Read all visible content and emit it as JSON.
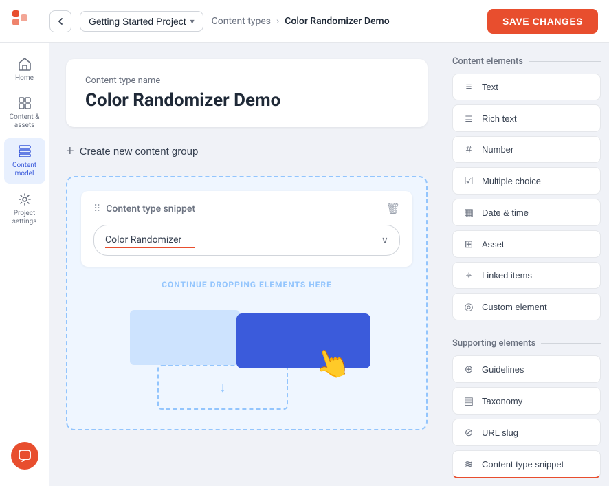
{
  "topbar": {
    "back_label": "‹",
    "project_name": "Getting Started Project",
    "project_chevron": "▾",
    "breadcrumb_parent": "Content types",
    "breadcrumb_separator": "›",
    "breadcrumb_current": "Color Randomizer Demo",
    "save_label": "SAVE CHANGES"
  },
  "sidebar": {
    "items": [
      {
        "id": "home",
        "label": "Home",
        "icon": "home"
      },
      {
        "id": "content",
        "label": "Content & assets",
        "icon": "content"
      },
      {
        "id": "content-model",
        "label": "Content model",
        "icon": "model",
        "active": true
      },
      {
        "id": "project-settings",
        "label": "Project settings",
        "icon": "settings"
      }
    ],
    "chat_btn_label": "Chat"
  },
  "main": {
    "content_type_label": "Content type name",
    "content_type_name": "Color Randomizer Demo",
    "create_group_label": "Create new content group",
    "drop_zone": {
      "snippet_title": "Content type snippet",
      "snippet_value": "Color Randomizer",
      "drop_label": "CONTINUE DROPPING ELEMENTS HERE"
    }
  },
  "right_panel": {
    "content_elements_title": "Content elements",
    "elements": [
      {
        "id": "text",
        "label": "Text",
        "icon": "≡"
      },
      {
        "id": "rich-text",
        "label": "Rich text",
        "icon": "≣"
      },
      {
        "id": "number",
        "label": "Number",
        "icon": "#"
      },
      {
        "id": "multiple-choice",
        "label": "Multiple choice",
        "icon": "☑"
      },
      {
        "id": "date-time",
        "label": "Date & time",
        "icon": "▦"
      },
      {
        "id": "asset",
        "label": "Asset",
        "icon": "⊞"
      },
      {
        "id": "linked-items",
        "label": "Linked items",
        "icon": "⌖"
      },
      {
        "id": "custom-element",
        "label": "Custom element",
        "icon": "◎"
      }
    ],
    "supporting_elements_title": "Supporting elements",
    "supporting": [
      {
        "id": "guidelines",
        "label": "Guidelines",
        "icon": "⊕"
      },
      {
        "id": "taxonomy",
        "label": "Taxonomy",
        "icon": "▤"
      },
      {
        "id": "url-slug",
        "label": "URL slug",
        "icon": "⊘"
      },
      {
        "id": "content-type-snippet",
        "label": "Content type snippet",
        "icon": "≋",
        "underline": true
      }
    ]
  }
}
